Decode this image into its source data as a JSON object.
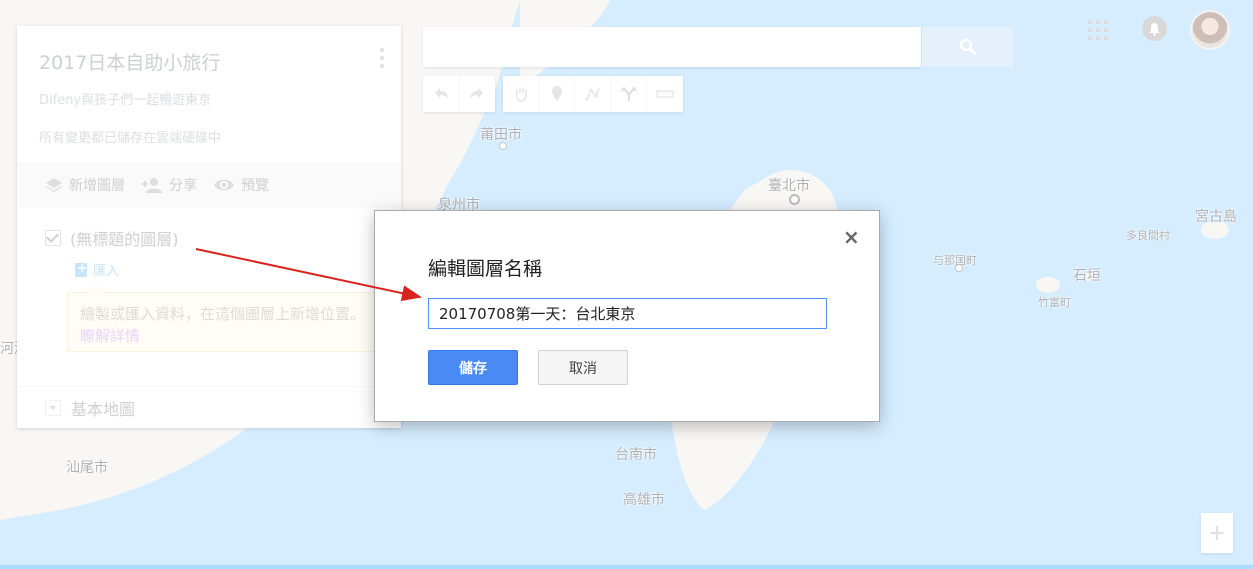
{
  "map": {
    "labels": {
      "putian": "莆田市",
      "quanzhou": "泉州市",
      "taipei": "臺北市",
      "yonaguni": "与那国町",
      "taketomi": "竹富町",
      "ishigaki": "石垣",
      "tarama": "多良間村",
      "miyakojima": "宮古島",
      "tainan": "台南市",
      "kaohsiung": "高雄市",
      "shanwei": "汕尾市",
      "heyuan_partial": "河源"
    },
    "colors": {
      "sea": "#aadaff",
      "land": "#f2efe9"
    }
  },
  "panel": {
    "title": "2017日本自助小旅行",
    "description": "Difeny與孩子們一起暢遊東京",
    "save_status": "所有變更都已儲存在雲端硬碟中",
    "actions": {
      "add_layer": "新增圖層",
      "share": "分享",
      "preview": "預覽"
    },
    "layer": {
      "name": "(無標題的圖層)",
      "import_label": "匯入",
      "hint_text": "繪製或匯入資料，在這個圖層上新增位置。",
      "learn_more": "瞭解詳情"
    },
    "basemap_label": "基本地圖"
  },
  "search": {
    "value": "",
    "placeholder": ""
  },
  "toolbar": {
    "icons": [
      "undo-icon",
      "redo-icon",
      "hand-icon",
      "marker-icon",
      "draw-line-icon",
      "directions-icon",
      "ruler-icon"
    ]
  },
  "dialog": {
    "title": "編輯圖層名稱",
    "input_value": "20170708第一天：台北東京",
    "save_label": "儲存",
    "cancel_label": "取消",
    "close_glyph": "×"
  },
  "zoom": {
    "in_label": "+"
  },
  "annotation": {
    "arrow_color": "#d9231d"
  },
  "accent_color": "#4a8af4"
}
